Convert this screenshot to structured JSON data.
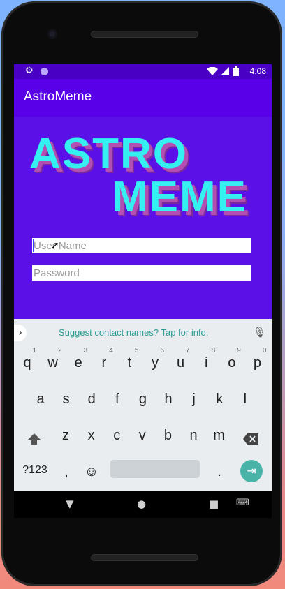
{
  "status": {
    "time": "4:08",
    "icons": [
      "gear-icon",
      "circle-icon",
      "wifi-icon",
      "signal-icon",
      "battery-icon"
    ]
  },
  "app": {
    "title": "AstroMeme"
  },
  "logo": {
    "line1": "ASTRO",
    "line2": "MEME"
  },
  "form": {
    "username_placeholder": "User Name",
    "password_placeholder": "Password"
  },
  "suggest": {
    "text": "Suggest contact names? Tap for info."
  },
  "keyboard": {
    "row1": [
      {
        "ch": "q",
        "num": "1"
      },
      {
        "ch": "w",
        "num": "2"
      },
      {
        "ch": "e",
        "num": "3"
      },
      {
        "ch": "r",
        "num": "4"
      },
      {
        "ch": "t",
        "num": "5"
      },
      {
        "ch": "y",
        "num": "6"
      },
      {
        "ch": "u",
        "num": "7"
      },
      {
        "ch": "i",
        "num": "8"
      },
      {
        "ch": "o",
        "num": "9"
      },
      {
        "ch": "p",
        "num": "0"
      }
    ],
    "row2": [
      "a",
      "s",
      "d",
      "f",
      "g",
      "h",
      "j",
      "k",
      "l"
    ],
    "row3": [
      "z",
      "x",
      "c",
      "v",
      "b",
      "n",
      "m"
    ],
    "symbols_label": "?123",
    "comma": ",",
    "period": "."
  },
  "colors": {
    "status_bar": "#4a00c4",
    "app_bar": "#5a00e8",
    "content_bg": "#5a10e6",
    "logo_cyan": "#35f0f0",
    "accent_teal": "#4ab3a8"
  }
}
